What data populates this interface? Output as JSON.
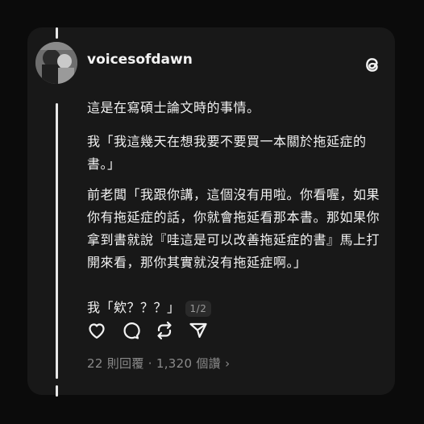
{
  "post": {
    "username": "voicesofdawn",
    "paragraphs": [
      "這是在寫碩士論文時的事情。",
      "我「我這幾天在想我要不要買一本關於拖延症的書。」",
      "前老闆「我跟你講，這個沒有用啦。你看喔，如果你有拖延症的話，你就會拖延看那本書。那如果你拿到書就說『哇這是可以改善拖延症的書』馬上打開來看，那你其實就沒有拖延症啊。」",
      "我「欸？？？」"
    ],
    "page_indicator": "1/2",
    "stats": "22 則回覆 · 1,320 個讚",
    "stats_chevron": "›"
  },
  "icons": {
    "brand": "threads-logo-icon",
    "like": "heart-icon",
    "reply": "comment-icon",
    "repost": "repost-icon",
    "share": "send-icon"
  },
  "colors": {
    "background": "#0b0b0b",
    "card": "#181818",
    "text": "#f2f2f2",
    "muted": "#8a8a8a"
  }
}
